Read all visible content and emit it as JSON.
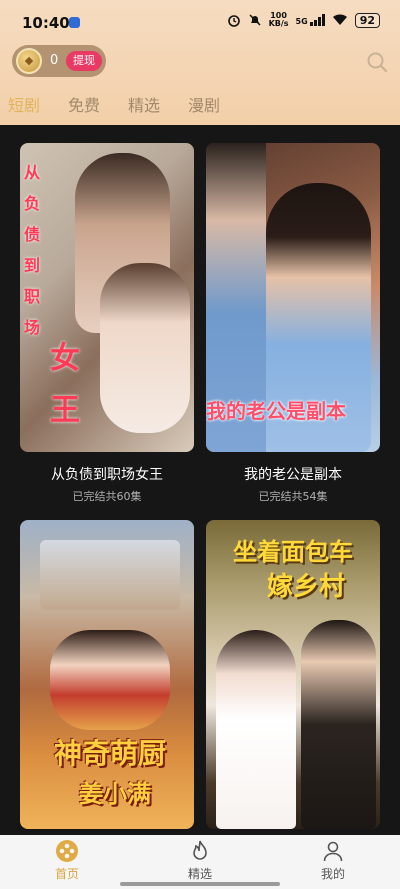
{
  "status_bar": {
    "time": "10:40",
    "speed_value": "100",
    "speed_unit": "KB/s",
    "network": "5G",
    "battery": "92"
  },
  "header": {
    "coin_count": "0",
    "withdraw_label": "提现"
  },
  "tabs": [
    {
      "label": "短剧",
      "active": true
    },
    {
      "label": "免费",
      "active": false
    },
    {
      "label": "精选",
      "active": false
    },
    {
      "label": "漫剧",
      "active": false
    }
  ],
  "dramas": [
    {
      "title": "从负债到职场女王",
      "subtitle": "已完结共60集",
      "poster_text_left": "从负债到职场",
      "poster_text_big": "女王"
    },
    {
      "title": "我的老公是副本",
      "subtitle": "已完结共54集",
      "poster_text": "我的老公是副本"
    },
    {
      "poster_text_1": "神奇萌厨",
      "poster_text_2": "姜小满"
    },
    {
      "poster_text_1": "坐着面包车",
      "poster_text_2": "嫁乡村"
    }
  ],
  "bottom_nav": [
    {
      "label": "首页",
      "active": true
    },
    {
      "label": "精选",
      "active": false
    },
    {
      "label": "我的",
      "active": false
    }
  ],
  "colors": {
    "accent": "#e1b45c",
    "header_bg": "#f2cfa9",
    "withdraw": "#e83a64"
  }
}
